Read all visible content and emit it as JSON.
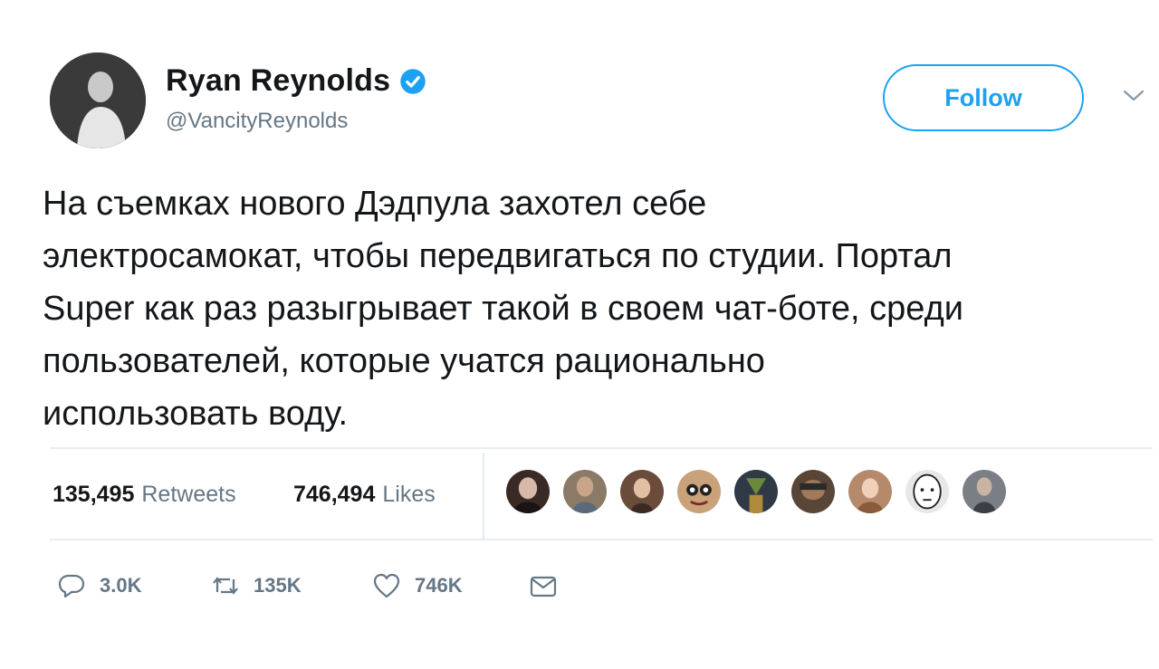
{
  "user": {
    "name": "Ryan Reynolds",
    "handle": "@VancityReynolds",
    "verified_color": "#1da1f2"
  },
  "follow_button": {
    "label": "Follow"
  },
  "tweet": {
    "text": "На съемках нового Дэдпула захотел себе\nэлектросамокат, чтобы передвигаться по студии. Портал\nSuper как раз разыгрывает такой в своем чат-боте, среди\nпользователей, которые учатся рационально\nиспользовать воду."
  },
  "stats": {
    "retweets_count": "135,495",
    "retweets_label": "Retweets",
    "likes_count": "746,494",
    "likes_label": "Likes"
  },
  "likers": [
    {
      "icon": "liker-avatar-1",
      "color": "#3a2a26"
    },
    {
      "icon": "liker-avatar-2",
      "color": "#8a7a66"
    },
    {
      "icon": "liker-avatar-3",
      "color": "#6b4b3a"
    },
    {
      "icon": "liker-avatar-4",
      "color": "#c9a27a"
    },
    {
      "icon": "liker-avatar-5",
      "color": "#2f3a46"
    },
    {
      "icon": "liker-avatar-6",
      "color": "#5a4636"
    },
    {
      "icon": "liker-avatar-7",
      "color": "#b58a6a"
    },
    {
      "icon": "liker-avatar-8",
      "color": "#e8e8e8"
    },
    {
      "icon": "liker-avatar-9",
      "color": "#7a7f86"
    }
  ],
  "actions": {
    "reply": {
      "icon": "reply-icon",
      "count": "3.0K"
    },
    "retweet": {
      "icon": "retweet-icon",
      "count": "135K"
    },
    "like": {
      "icon": "heart-icon",
      "count": "746K"
    },
    "dm": {
      "icon": "envelope-icon"
    }
  },
  "colors": {
    "accent": "#1da1f2",
    "text": "#14171a",
    "muted": "#657786",
    "divider": "#e6ecf0"
  }
}
